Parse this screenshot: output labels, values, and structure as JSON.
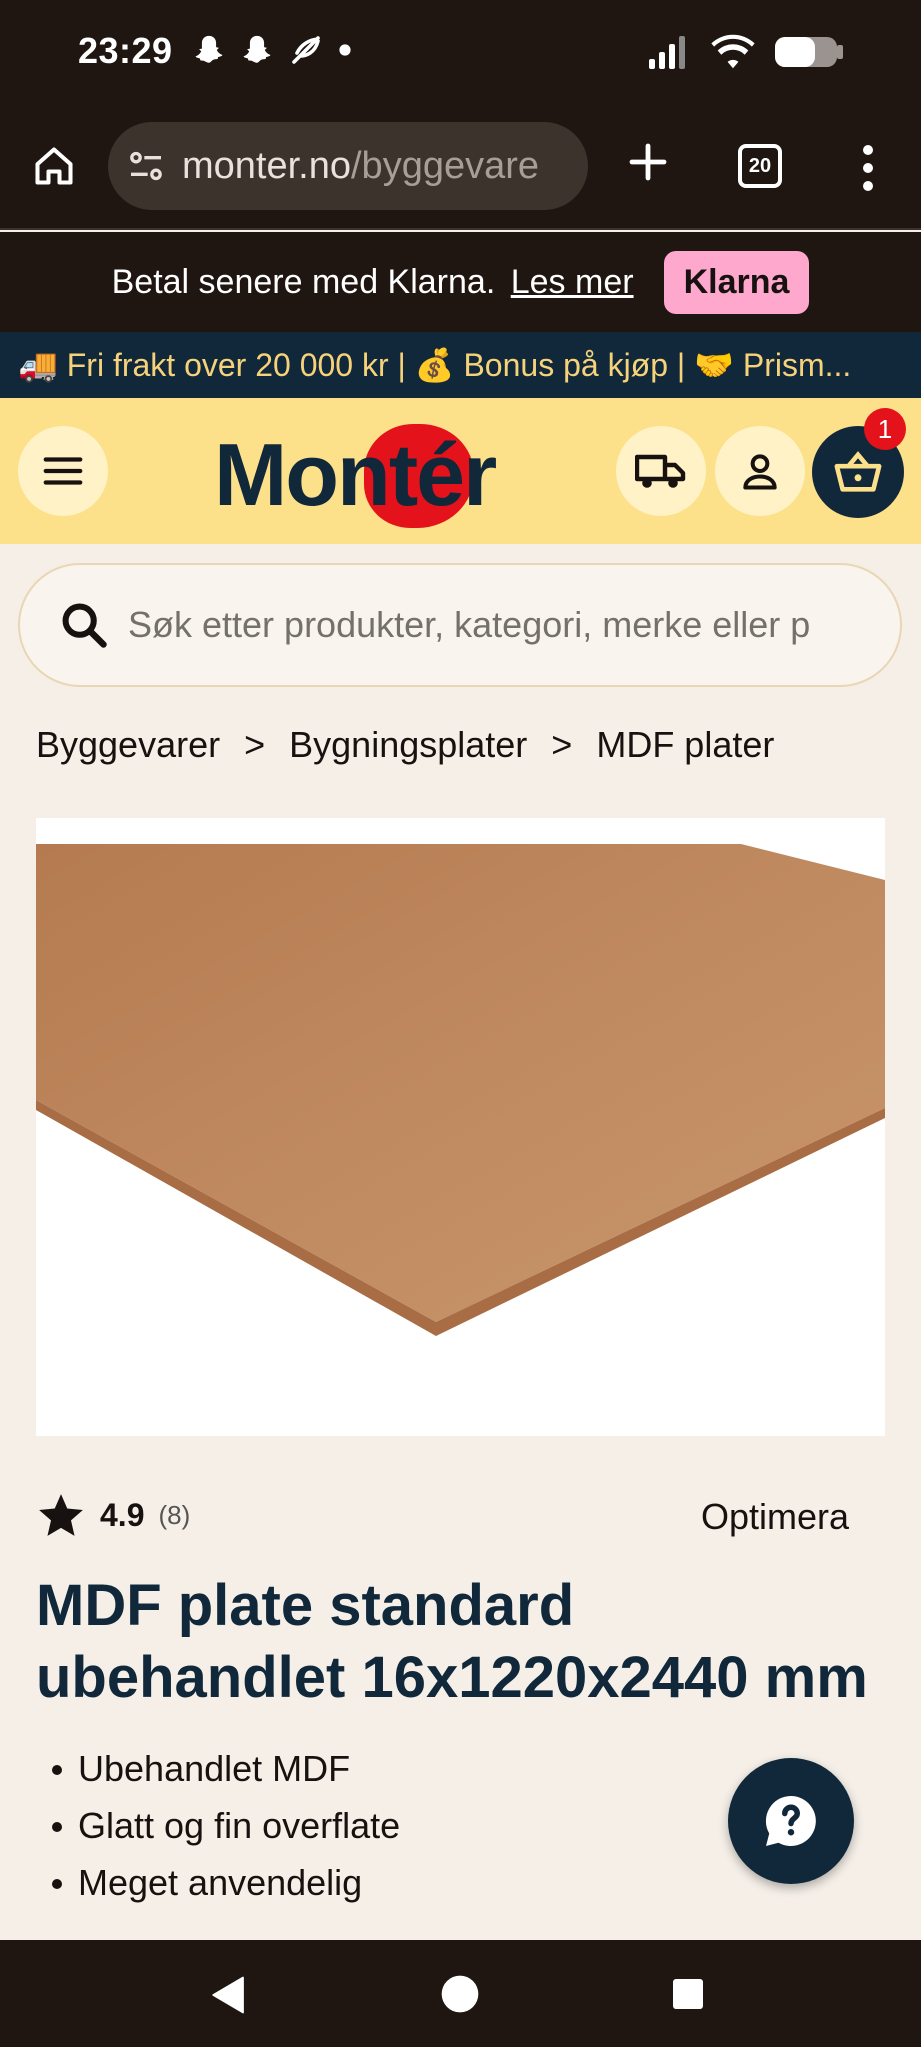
{
  "status_bar": {
    "time": "23:29"
  },
  "browser": {
    "url_host": "monter.no",
    "url_path": "/byggevare",
    "tab_count": "20"
  },
  "klarna": {
    "text": "Betal senere med Klarna.",
    "link": "Les mer",
    "badge": "Klarna"
  },
  "promo": {
    "text": "🚚 Fri frakt over 20 000 kr | 💰 Bonus på kjøp | 🤝 Prism..."
  },
  "header": {
    "logo": "Montér",
    "cart_count": "1"
  },
  "search": {
    "placeholder": "Søk etter produkter, kategori, merke eller p"
  },
  "breadcrumb": {
    "items": [
      "Byggevarer",
      "Bygningsplater",
      "MDF plater"
    ],
    "separator": ">"
  },
  "product": {
    "rating": "4.9",
    "rating_count": "(8)",
    "brand": "Optimera",
    "title": "MDF plate standard ubehandlet 16x1220x2440 mm",
    "features": [
      "Ubehandlet MDF",
      "Glatt og fin overflate",
      "Meget anvendelig"
    ]
  },
  "colors": {
    "dark": "#1f1612",
    "navy": "#10283a",
    "yellow": "#fde08a",
    "red": "#e4121b",
    "klarna_pink": "#ffa8cd"
  }
}
